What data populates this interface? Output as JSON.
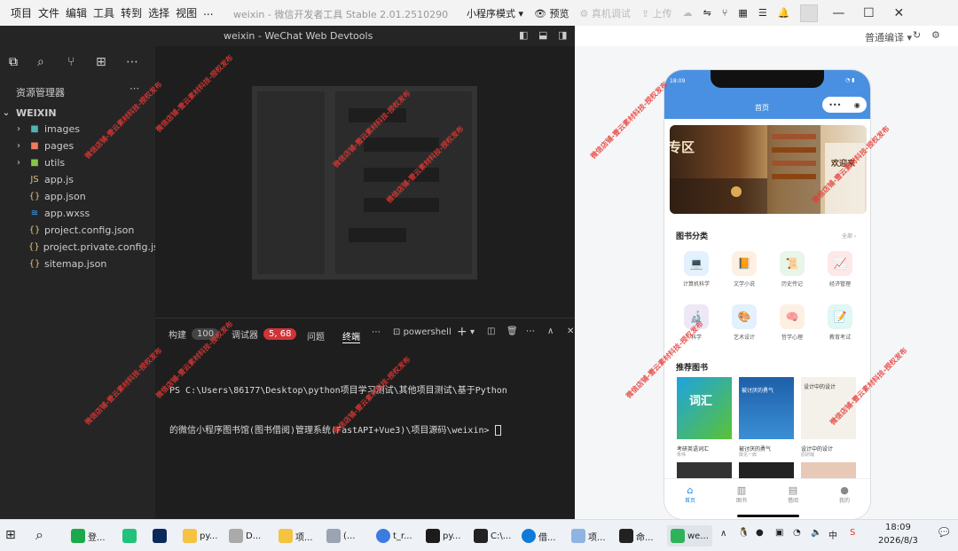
{
  "titlebar": {
    "menu": [
      "项目",
      "文件",
      "编辑",
      "工具",
      "转到",
      "选择",
      "视图",
      "..."
    ],
    "window_title": "weixin - 微信开发者工具 Stable 2.01.2510290",
    "mode": "小程序模式",
    "preview": "预览",
    "real_debug": "真机调试",
    "upload": "上传"
  },
  "editor_bar": {
    "title": "weixin - WeChat Web Devtools"
  },
  "simulator_bar": {
    "compile": "普通编译"
  },
  "explorer": {
    "title": "资源管理器",
    "root": "WEIXIN",
    "items": [
      {
        "name": "images",
        "type": "folder"
      },
      {
        "name": "pages",
        "type": "folder"
      },
      {
        "name": "utils",
        "type": "folder"
      },
      {
        "name": "app.js",
        "type": "js"
      },
      {
        "name": "app.json",
        "type": "json"
      },
      {
        "name": "app.wxss",
        "type": "wxss"
      },
      {
        "name": "project.config.json",
        "type": "json"
      },
      {
        "name": "project.private.config.js...",
        "type": "json"
      },
      {
        "name": "sitemap.json",
        "type": "json"
      }
    ]
  },
  "panel": {
    "tabs": [
      {
        "label": "构建",
        "badge": "100"
      },
      {
        "label": "调试器",
        "badge": "5, 68"
      },
      {
        "label": "问题",
        "badge": ""
      },
      {
        "label": "终端",
        "badge": ""
      }
    ],
    "shell": "powershell",
    "terminal_line1": "PS C:\\Users\\86177\\Desktop\\python项目学习测试\\其他项目测试\\基于Python",
    "terminal_line2": "的微信小程序图书馆(图书借阅)管理系统(FastAPI+Vue3)\\项目源码\\weixin> "
  },
  "phone": {
    "status_time": "18:09",
    "nav_title": "首页",
    "banner_text_left": "专区",
    "banner_text_right": "欢迎来",
    "categories_title": "图书分类",
    "categories_more": "全部 ›",
    "categories": [
      {
        "label": "计算机科学",
        "icon": "💻",
        "color": "#e3f0fd"
      },
      {
        "label": "文学小说",
        "icon": "📙",
        "color": "#fdf0e3"
      },
      {
        "label": "历史传记",
        "icon": "📜",
        "color": "#e8f5e9"
      },
      {
        "label": "经济管理",
        "icon": "📈",
        "color": "#fde8e8"
      },
      {
        "label": "科学",
        "icon": "🔬",
        "color": "#ede7f6"
      },
      {
        "label": "艺术设计",
        "icon": "🎨",
        "color": "#e3f0fd"
      },
      {
        "label": "哲学心理",
        "icon": "🧠",
        "color": "#fdf0e3"
      },
      {
        "label": "教育考试",
        "icon": "📝",
        "color": "#e0f7f4"
      }
    ],
    "recommend_title": "推荐图书",
    "books": [
      {
        "title": "考研英语词汇",
        "author": "朱伟",
        "cover_text": "词汇"
      },
      {
        "title": "被讨厌的勇气",
        "author": "岸见一郎",
        "cover_text": "被讨厌的勇气"
      },
      {
        "title": "设计中的设计",
        "author": "原研哉",
        "cover_text": "设计中的设计"
      }
    ],
    "tabbar": [
      {
        "label": "首页",
        "icon": "home-icon"
      },
      {
        "label": "图书",
        "icon": "book-icon"
      },
      {
        "label": "借阅",
        "icon": "borrow-icon"
      },
      {
        "label": "我的",
        "icon": "user-icon"
      }
    ]
  },
  "taskbar": {
    "items": [
      "登...",
      "py...",
      "D...",
      "项...",
      "(...",
      "t_r...",
      "py...",
      "C:\\...",
      "借...",
      "项...",
      "命...",
      "we..."
    ],
    "time": "18:09",
    "date": "2026/8/3"
  },
  "watermark": "微信店铺-壹云素材科技-授权发布"
}
